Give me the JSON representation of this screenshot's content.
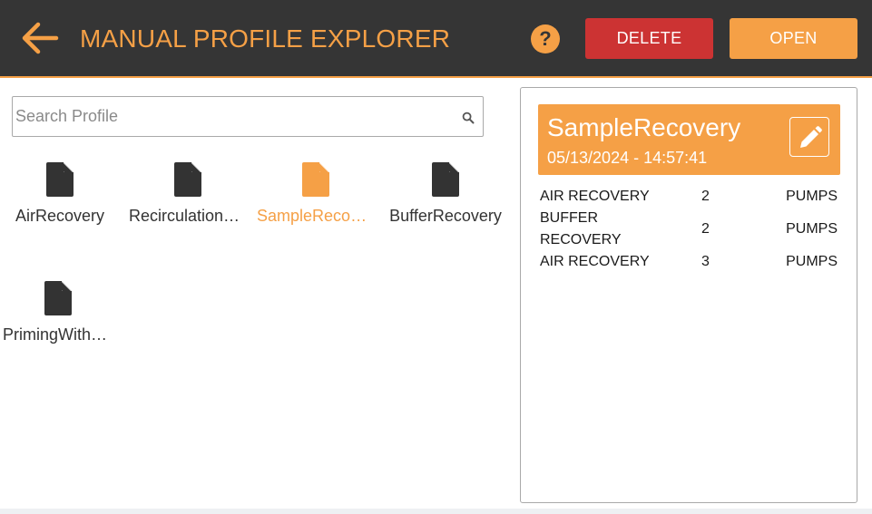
{
  "header": {
    "title": "MANUAL PROFILE EXPLORER",
    "help_label": "?",
    "delete_label": "DELETE",
    "open_label": "OPEN"
  },
  "search": {
    "placeholder": "Search Profile",
    "value": ""
  },
  "files": [
    {
      "label": "AirRecovery",
      "selected": false
    },
    {
      "label": "RecirculationWithMedia",
      "selected": false
    },
    {
      "label": "SampleRecovery",
      "selected": true
    },
    {
      "label": "BufferRecovery",
      "selected": false
    },
    {
      "label": "PrimingWithMedia",
      "selected": false
    }
  ],
  "details": {
    "name": "SampleRecovery",
    "datetime": "05/13/2024 - 14:57:41",
    "steps": [
      {
        "name": "AIR RECOVERY",
        "count": "2",
        "unit": "PUMPS"
      },
      {
        "name": "BUFFER RECOVERY",
        "count": "2",
        "unit": "PUMPS"
      },
      {
        "name": "AIR RECOVERY",
        "count": "3",
        "unit": "PUMPS"
      }
    ]
  },
  "colors": {
    "accent": "#f5a046",
    "header_bg": "#353535",
    "delete": "#cc3333",
    "icon_dark": "#333333"
  },
  "icons": {
    "back": "arrow-left-icon",
    "help": "question-icon",
    "search": "search-icon",
    "file": "file-icon",
    "edit": "pencil-icon"
  }
}
